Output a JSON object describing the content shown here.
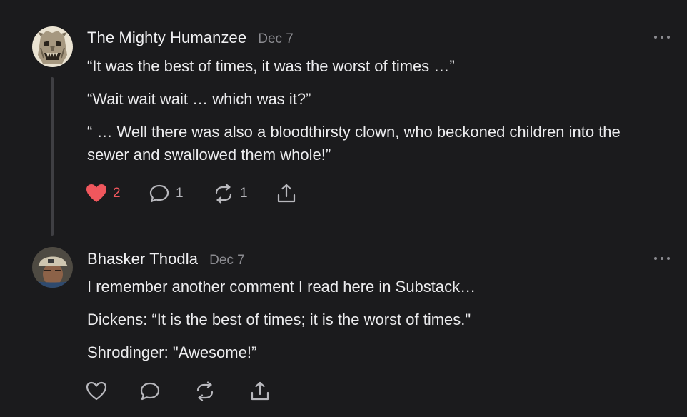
{
  "comments": [
    {
      "author": "The Mighty Humanzee",
      "date": "Dec 7",
      "avatar_icon": "carved-stone-face-avatar",
      "paragraphs": [
        "“It was the best of times, it was the worst of times …”",
        "“Wait wait wait … which was it?”",
        "“ … Well there was also a bloodthirsty clown, who beckoned children into the sewer and swallowed them whole!”"
      ],
      "likes": "2",
      "liked": true,
      "replies": "1",
      "restacks": "1"
    },
    {
      "author": "Bhasker Thodla",
      "date": "Dec 7",
      "avatar_icon": "man-in-cap-avatar",
      "paragraphs": [
        "I remember another comment I read here in Substack…",
        "Dickens: “It is the best of times; it is the worst of times.\"",
        "Shrodinger: \"Awesome!”"
      ],
      "liked": false
    }
  ],
  "icons": {
    "like": "heart-icon",
    "reply": "speech-bubble-icon",
    "restack": "restack-arrows-icon",
    "share": "share-icon",
    "more": "more-dots-icon"
  },
  "colors": {
    "background": "#1b1b1d",
    "text": "#ececee",
    "muted": "#8b8b90",
    "liked": "#f0575d",
    "thread_line": "#3f3f43"
  }
}
